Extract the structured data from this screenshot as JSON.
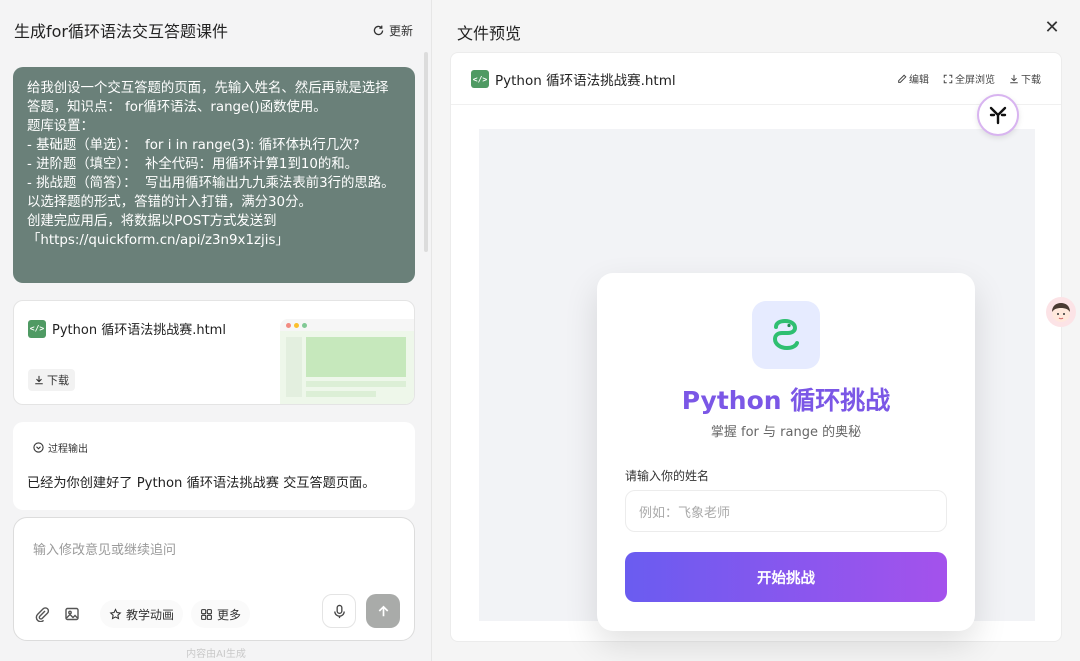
{
  "left": {
    "title": "生成for循环语法交互答题课件",
    "update_label": "更新",
    "prompt_text": "给我创设一个交互答题的页面，先输入姓名、然后再就是选择答题，知识点： for循环语法、range()函数使用。\n题库设置：\n- 基础题（单选）：  for i in range(3): 循环体执行几次?\n- 进阶题（填空）：  补全代码：用循环计算1到10的和。\n- 挑战题（简答）：  写出用循环输出九九乘法表前3行的思路。\n以选择题的形式，答错的计入打错，满分30分。\n创建完应用后，将数据以POST方式发送到 「https://quickform.cn/api/z3n9x1zjis」",
    "file_card": {
      "filename": "Python 循环语法挑战赛.html",
      "icon_text": "</>",
      "download_label": "下载"
    },
    "process": {
      "tag_label": "过程输出",
      "text": "已经为你创建好了 Python 循环语法挑战赛 交互答题页面。"
    },
    "input": {
      "placeholder": "输入修改意见或继续追问",
      "teach_anim_label": "教学动画",
      "more_label": "更多"
    },
    "footnote": "内容由AI生成"
  },
  "right": {
    "title": "文件预览",
    "close_glyph": "✕",
    "preview": {
      "filename": "Python 循环语法挑战赛.html",
      "icon_text": "</>",
      "edit_label": "编辑",
      "fullscreen_label": "全屏浏览",
      "download_label": "下载"
    },
    "quiz": {
      "title": "Python 循环挑战",
      "subtitle": "掌握 for 与 range 的奥秘",
      "name_label": "请输入你的姓名",
      "name_placeholder": "例如：飞象老师",
      "start_button": "开始挑战"
    }
  },
  "colors": {
    "prompt_bg": "#6a8079",
    "accent_purple": "#7b57e6",
    "button_gradient_start": "#6a5cf0",
    "button_gradient_end": "#a452ec",
    "file_icon_green": "#4f9a63",
    "logo_green": "#2fbf71"
  }
}
